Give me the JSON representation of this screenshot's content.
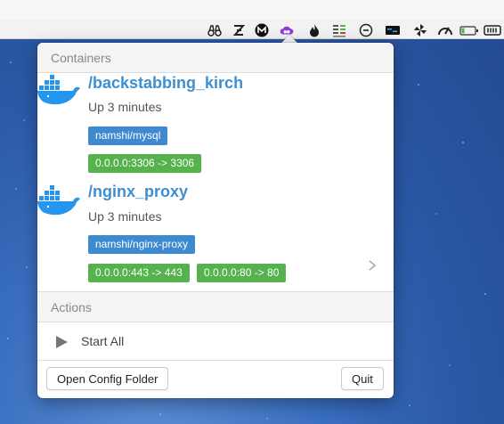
{
  "menubar": {
    "icons": [
      "binoculars-icon",
      "z-icon",
      "m-icon",
      "creative-cloud-icon",
      "flame-icon",
      "stats-icon",
      "minus-circle-icon",
      "terminal-icon",
      "pinwheel-icon",
      "gauge-icon",
      "battery-icon",
      "keyboard-icon"
    ]
  },
  "popover": {
    "containers_header": "Containers",
    "containers": [
      {
        "name": "/backstabbing_kirch",
        "status": "Up 3 minutes",
        "image": "namshi/mysql",
        "ports": [
          "0.0.0.0:3306 -> 3306"
        ]
      },
      {
        "name": "/nginx_proxy",
        "status": "Up 3 minutes",
        "image": "namshi/nginx-proxy",
        "ports": [
          "0.0.0.0:443 -> 443",
          "0.0.0.0:80 -> 80"
        ]
      }
    ],
    "actions_header": "Actions",
    "start_all_label": "Start All",
    "open_config_label": "Open Config Folder",
    "quit_label": "Quit"
  },
  "colors": {
    "name_blue": "#3c8fd2",
    "badge_blue": "#3d8ad0",
    "badge_green": "#55b24d",
    "docker_blue": "#2496ed"
  }
}
